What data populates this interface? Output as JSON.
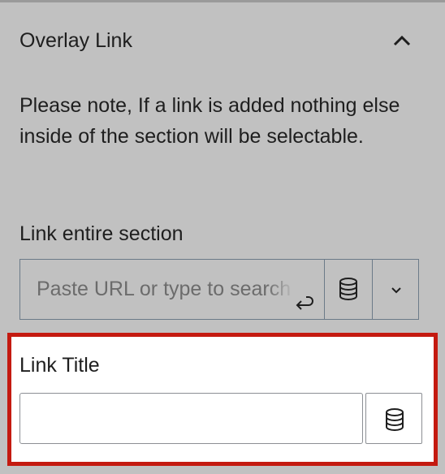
{
  "panel": {
    "title": "Overlay Link",
    "collapse_icon": "chevron-up-icon"
  },
  "note": "Please note, If a link is added nothing else inside of the section will be selectable.",
  "link_field": {
    "label": "Link entire section",
    "placeholder": "Paste URL or type to search",
    "submit_icon": "enter-icon",
    "dynamic_icon": "database-icon",
    "dropdown_icon": "chevron-down-icon"
  },
  "title_field": {
    "label": "Link Title",
    "value": "",
    "dynamic_icon": "database-icon"
  },
  "colors": {
    "panel_bg": "#c1c1c1",
    "highlight_border": "#c41a10",
    "text": "#1e1e1e"
  }
}
